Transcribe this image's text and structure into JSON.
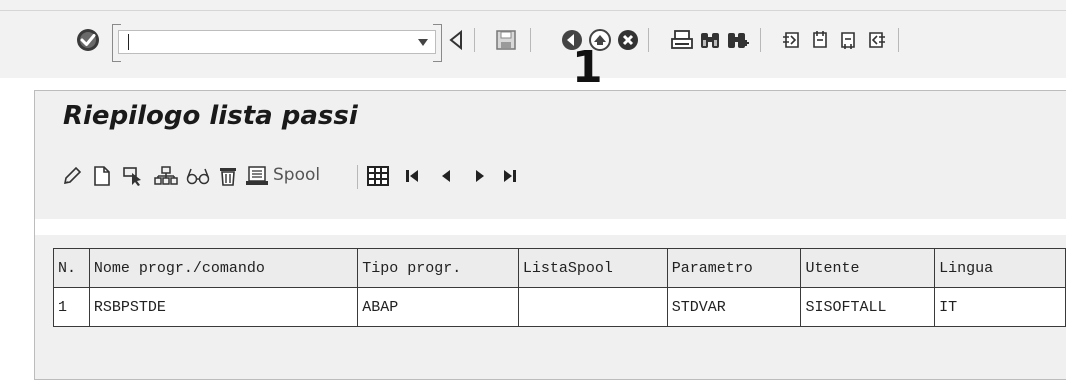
{
  "toolbar": {
    "command_field": {
      "value": "",
      "placeholder": ""
    },
    "icons": [
      "enter-check-icon",
      "dropdown-icon",
      "back-triangle-icon",
      "save-icon",
      "back-icon",
      "exit-icon",
      "cancel-icon",
      "print-icon",
      "find-icon",
      "find-next-icon",
      "first-page-icon",
      "previous-page-icon",
      "next-page-icon",
      "last-page-icon"
    ]
  },
  "annotation": {
    "label": "1"
  },
  "panel": {
    "title": "Riepilogo lista passi",
    "toolbar": {
      "icons": [
        "edit-icon",
        "create-icon",
        "select-icon",
        "structure-icon",
        "glasses-icon",
        "delete-icon",
        "spool-icon",
        "grid-icon",
        "first-icon",
        "previous-icon",
        "next-icon",
        "last-icon"
      ],
      "spool_label": "Spool"
    }
  },
  "steps_table": {
    "headers": [
      "N.",
      "Nome progr./comando",
      "Tipo progr.",
      "ListaSpool",
      "Parametro",
      "Utente",
      "Lingua"
    ],
    "rows": [
      [
        "1",
        "RSBPSTDE",
        "ABAP",
        "",
        "STDVAR",
        "SISOFTALL",
        "IT"
      ]
    ]
  },
  "colors": {
    "background": "#ffffff",
    "toolbar": "#f2f2f2",
    "panel": "#f0f0f0",
    "grid_border": "#3a3a3a"
  }
}
